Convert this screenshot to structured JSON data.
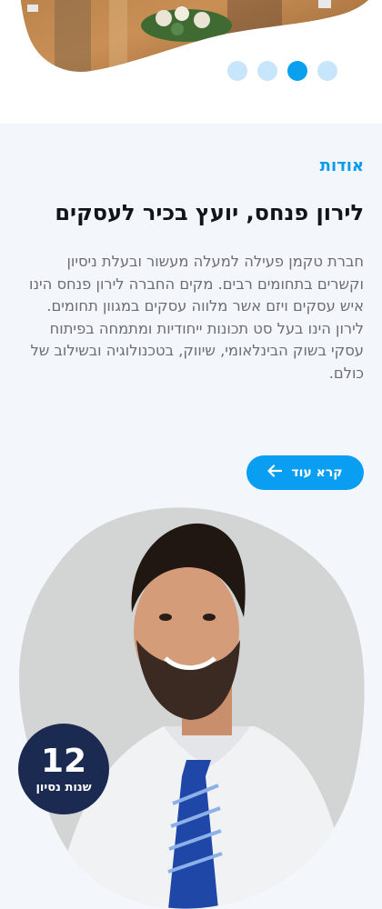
{
  "hero": {
    "carousel_dots": 4,
    "active_dot": 3
  },
  "about": {
    "eyebrow": "אודות",
    "title": "לירון פנחס, יועץ בכיר לעסקים",
    "paragraph": "חברת טקמן פעילה למעלה מעשור ובעלת ניסיון וקשרים בתחומים רבים. מקים החברה לירון פנחס הינו איש עסקים ויזם אשר מלווה עסקים במגוון תחומים.\nלירון הינו בעל סט תכונות ייחודיות ומתמחה בפיתוח עסקי בשוק הבינלאומי,  שיווק, בטכנולוגיה ובשילוב של כולם.",
    "cta_label": "קרא עוד",
    "cta_icon": "arrow-left-icon"
  },
  "badge": {
    "number": "12",
    "label": "שנות נסיון"
  },
  "colors": {
    "accent": "#0a9ef2",
    "badge_bg": "#1b2a50",
    "section_bg": "#f3f6fa"
  }
}
